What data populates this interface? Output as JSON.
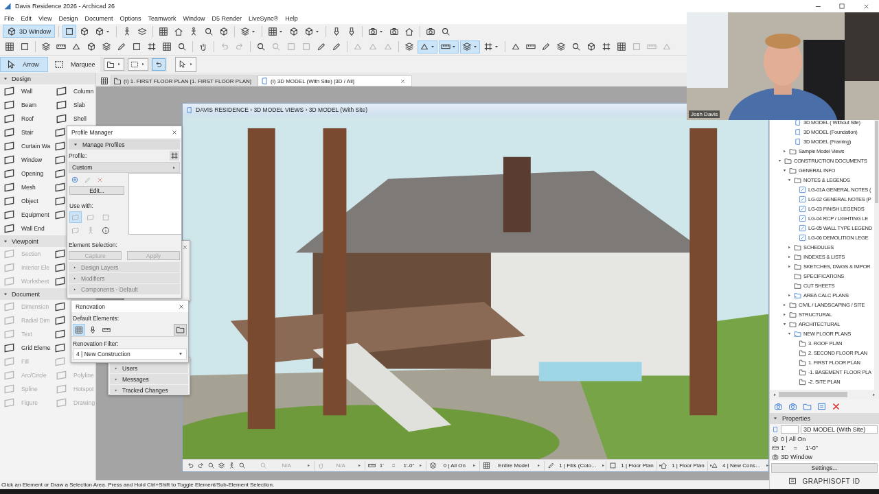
{
  "window": {
    "title": "Davis Residence 2026 - Archicad 26"
  },
  "menu": [
    "File",
    "Edit",
    "View",
    "Design",
    "Document",
    "Options",
    "Teamwork",
    "Window",
    "D5 Render",
    "LiveSync®",
    "Help"
  ],
  "toolbar": {
    "view_button": {
      "label": "3D Window",
      "selected": true
    },
    "row_1": [
      {
        "selected": true
      },
      {
        "selected": false
      },
      {
        "selected": false
      },
      {
        "selected": false
      },
      {
        "selected": false
      },
      {
        "selected": false
      },
      {
        "selected": false
      },
      {
        "selected": false
      },
      {
        "selected": false
      },
      {
        "selected": false
      },
      {
        "selected": false
      },
      {
        "selected": false
      },
      {
        "selected": false
      },
      {
        "selected": false
      },
      {
        "selected": false
      },
      {
        "selected": false
      },
      {
        "selected": false
      },
      {
        "selected": false
      },
      {
        "selected": false
      },
      {
        "selected": false
      },
      {
        "selected": false
      }
    ],
    "row_2": [
      {
        "selected": false,
        "disabled": false
      },
      {
        "selected": false,
        "disabled": false
      },
      {
        "selected": false,
        "disabled": false
      },
      {
        "selected": false,
        "disabled": false
      },
      {
        "selected": false,
        "disabled": false
      },
      {
        "selected": false,
        "disabled": false
      },
      {
        "selected": false,
        "disabled": false
      },
      {
        "selected": false,
        "disabled": false
      },
      {
        "selected": false,
        "disabled": false
      },
      {
        "selected": false,
        "disabled": false
      },
      {
        "selected": false,
        "disabled": false
      },
      {
        "selected": false,
        "disabled": false
      },
      {
        "selected": false,
        "disabled": false
      },
      {
        "selected": false,
        "disabled": true
      },
      {
        "selected": false,
        "disabled": true
      },
      {
        "selected": false,
        "disabled": false
      },
      {
        "selected": false,
        "disabled": true
      },
      {
        "selected": false,
        "disabled": true
      },
      {
        "selected": false,
        "disabled": true
      },
      {
        "selected": false,
        "disabled": false
      },
      {
        "selected": false,
        "disabled": false
      },
      {
        "selected": false,
        "disabled": true
      },
      {
        "selected": false,
        "disabled": true
      },
      {
        "selected": false,
        "disabled": true
      },
      {
        "selected": false,
        "disabled": false
      },
      {
        "selected": true,
        "disabled": false
      },
      {
        "selected": true,
        "disabled": false
      },
      {
        "selected": true,
        "disabled": false
      },
      {
        "selected": false,
        "disabled": false
      },
      {
        "selected": false,
        "disabled": false
      },
      {
        "selected": false,
        "disabled": false
      },
      {
        "selected": false,
        "disabled": false
      },
      {
        "selected": false,
        "disabled": false
      },
      {
        "selected": false,
        "disabled": false
      },
      {
        "selected": false,
        "disabled": false
      },
      {
        "selected": false,
        "disabled": false
      },
      {
        "selected": false,
        "disabled": false
      },
      {
        "selected": false,
        "disabled": true
      },
      {
        "selected": false,
        "disabled": true
      },
      {
        "selected": false,
        "disabled": true
      }
    ],
    "info_box": [
      {
        "selected": false
      },
      {
        "selected": false
      },
      {
        "selected": true
      },
      {
        "selected": false
      }
    ]
  },
  "selection_tools": [
    {
      "label": "Arrow",
      "selected": true
    },
    {
      "label": "Marquee",
      "selected": false
    }
  ],
  "tabs": [
    {
      "label": "(I) 1. FIRST FLOOR PLAN [1. FIRST FLOOR PLAN]",
      "selected": false
    },
    {
      "label": "(I) 3D MODEL (With Site) [3D / All]",
      "selected": true
    }
  ],
  "toolbox": [
    {
      "title": "Design",
      "expanded": true,
      "tools": [
        {
          "label": "Wall",
          "disabled": false
        },
        {
          "label": "Column",
          "disabled": false
        },
        {
          "label": "Beam",
          "disabled": false
        },
        {
          "label": "Slab",
          "disabled": false
        },
        {
          "label": "Roof",
          "disabled": false
        },
        {
          "label": "Shell",
          "disabled": false
        },
        {
          "label": "Stair",
          "disabled": false
        },
        {
          "disabled": false
        },
        {
          "label": "Curtain Wa",
          "disabled": false
        },
        {
          "disabled": false
        },
        {
          "label": "Window",
          "disabled": false
        },
        {
          "disabled": false
        },
        {
          "label": "Opening",
          "disabled": false
        },
        {
          "disabled": false
        },
        {
          "label": "Mesh",
          "disabled": false
        },
        {
          "disabled": false
        },
        {
          "label": "Object",
          "disabled": false
        },
        {
          "disabled": false
        },
        {
          "label": "Equipment",
          "disabled": false
        },
        {
          "disabled": false
        },
        {
          "label": "Wall End",
          "disabled": false
        }
      ]
    },
    {
      "title": "Viewpoint",
      "expanded": true,
      "tools": [
        {
          "label": "Section",
          "disabled": true
        },
        {
          "disabled": false
        },
        {
          "label": "Interior Ele",
          "disabled": true
        },
        {
          "disabled": false
        },
        {
          "label": "Worksheet",
          "disabled": true
        },
        {
          "disabled": false
        }
      ]
    },
    {
      "title": "Document",
      "expanded": true,
      "tools": [
        {
          "label": "Dimension",
          "disabled": true
        },
        {
          "disabled": false
        },
        {
          "label": "Radial Dim",
          "disabled": true
        },
        {
          "disabled": false
        },
        {
          "label": "Text",
          "disabled": true
        },
        {
          "disabled": false
        },
        {
          "label": "Grid Eleme",
          "disabled": false
        },
        {
          "disabled": false
        },
        {
          "label": "Fill",
          "disabled": true
        },
        {
          "disabled": true
        },
        {
          "label": "Arc/Circle",
          "disabled": true
        },
        {
          "label": "Polyline",
          "disabled": true
        },
        {
          "label": "Spline",
          "disabled": true
        },
        {
          "label": "Hotspot",
          "disabled": true
        },
        {
          "label": "Figure",
          "disabled": true
        },
        {
          "label": "Drawing",
          "disabled": true
        }
      ]
    }
  ],
  "viewport": {
    "breadcrumb": "DAVIS RESIDENCE › 3D MODEL VIEWS › 3D MODEL (With Site)",
    "controls": [
      {
        "text": "N/A",
        "disabled": true
      },
      {
        "text": "N/A",
        "disabled": true
      },
      {
        "text": "0 | All On",
        "disabled": false
      },
      {
        "text": "Entire Model",
        "disabled": false
      },
      {
        "text": "1 | Fills (Colo…",
        "disabled": false
      },
      {
        "text": "1 | Floor Plan",
        "disabled": false
      },
      {
        "text": "1 | Floor Plan",
        "disabled": false
      },
      {
        "text": "4 | New Cons…",
        "disabled": false
      }
    ],
    "scale": [
      "1'",
      "=",
      "1'-0\""
    ]
  },
  "profile_manager": {
    "title": "Profile Manager",
    "section": {
      "label": "Manage Profiles",
      "expanded": true
    },
    "profile_label": "Profile:",
    "profile": "Custom",
    "edit_button": "Edit...",
    "use_with_label": "Use with:",
    "use_with": [
      {
        "selected": true
      },
      {
        "selected": false
      },
      {
        "selected": false
      },
      {
        "selected": false
      },
      {
        "selected": false
      }
    ],
    "element_selection_label": "Element Selection:",
    "buttons": [
      {
        "label": "Capture",
        "disabled": true
      },
      {
        "label": "Apply",
        "disabled": true
      }
    ],
    "groups": [
      {
        "label": "Design Layers",
        "disabled": true
      },
      {
        "label": "Modifiers",
        "disabled": true
      },
      {
        "label": "Components - Default",
        "disabled": true
      }
    ]
  },
  "renovation": {
    "title": "Renovation",
    "default_label": "Default Elements:",
    "statuses": [
      {
        "selected": true
      },
      {
        "selected": false
      },
      {
        "selected": false
      }
    ],
    "filter_label": "Renovation Filter:",
    "filter": "4 | New Construction"
  },
  "teamwork_palette": {
    "groups": [
      "Users",
      "Messages",
      "Tracked Changes"
    ]
  },
  "navigator": {
    "tree": [
      {
        "children": [
          {
            "children": [
              {
                "label": "3D MODEL ( Without Site)",
                "kind": "view"
              },
              {
                "label": "3D MODEL (Foundation)",
                "kind": "view"
              },
              {
                "label": "3D MODEL (Framing)",
                "kind": "view"
              }
            ]
          },
          {
            "label": "Sample Model Views",
            "kind": "folder",
            "expanded": false
          }
        ]
      },
      {
        "label": "CONSTRUCTION DOCUMENTS",
        "kind": "folder",
        "expanded": true,
        "children": [
          {
            "label": "GENERAL INFO",
            "kind": "folder",
            "expanded": true,
            "children": [
              {
                "label": "NOTES & LEGENDS",
                "kind": "folder",
                "expanded": true,
                "children": [
                  {
                    "label": "LG-01A GENERAL NOTES (",
                    "kind": "legend"
                  },
                  {
                    "label": "LG-02 GENERAL NOTES (P",
                    "kind": "legend"
                  },
                  {
                    "label": "LG-03 FINISH LEGENDS",
                    "kind": "legend"
                  },
                  {
                    "label": "LG-04 RCP / LIGHTING LE",
                    "kind": "legend"
                  },
                  {
                    "label": "LG-05 WALL TYPE LEGEND",
                    "kind": "legend"
                  },
                  {
                    "label": "LG-06 DEMOLITION LEGE",
                    "kind": "legend"
                  }
                ]
              },
              {
                "label": "SCHEDULES",
                "kind": "folder",
                "expanded": false
              },
              {
                "label": "INDEXES & LISTS",
                "kind": "folder",
                "expanded": false
              },
              {
                "label": "SKETCHES, DWGS & IMPOR",
                "kind": "folder",
                "expanded": false
              },
              {
                "label": "SPECIFICATIONS",
                "kind": "folder"
              },
              {
                "label": "CUT SHEETS",
                "kind": "folder"
              },
              {
                "label": "AREA CALC PLANS",
                "kind": "plan-folder",
                "expanded": false
              }
            ]
          },
          {
            "label": "CIVIL / LANDSCAPING / SITE",
            "kind": "folder",
            "expanded": false
          },
          {
            "label": "STRUCTURAL",
            "kind": "folder",
            "expanded": false
          },
          {
            "label": "ARCHITECTURAL",
            "kind": "folder",
            "expanded": true,
            "children": [
              {
                "label": "NEW FLOOR PLANS",
                "kind": "plan-folder",
                "expanded": true,
                "children": [
                  {
                    "label": "3. ROOF PLAN",
                    "kind": "plan"
                  },
                  {
                    "label": "2. SECOND FLOOR PLAN",
                    "kind": "plan"
                  },
                  {
                    "label": "1. FIRST FLOOR PLAN",
                    "kind": "plan"
                  },
                  {
                    "label": "-1. BASEMENT FLOOR PLA",
                    "kind": "plan"
                  },
                  {
                    "label": "-2. SITE PLAN",
                    "kind": "plan"
                  }
                ]
              }
            ]
          }
        ]
      }
    ],
    "properties": {
      "title": "Properties",
      "expanded": true,
      "view_name": "3D MODEL (With Site)",
      "layers": "0 | All On",
      "scale": [
        "1'",
        "=",
        "1'-0\""
      ],
      "mode": "3D Window",
      "settings_button": "Settings..."
    },
    "footer": "GRAPHISOFT ID"
  },
  "webcam": {
    "name": "Josh Davis"
  },
  "status_bar": "Click an Element or Draw a Selection Area. Press and Hold Ctrl+Shift to Toggle Element/Sub-Element Selection."
}
